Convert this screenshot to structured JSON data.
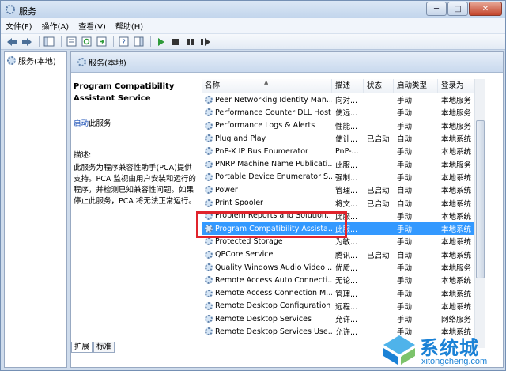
{
  "window": {
    "title": "服务"
  },
  "window_controls": {
    "minimize": "─",
    "maximize": "□",
    "close": "✕"
  },
  "menu": [
    "文件(F)",
    "操作(A)",
    "查看(V)",
    "帮助(H)"
  ],
  "tree": {
    "item": "服务(本地)"
  },
  "pane": {
    "header": "服务(本地)"
  },
  "description": {
    "title": "Program Compatibility Assistant Service",
    "start_link": "启动",
    "start_suffix": "此服务",
    "label": "描述:",
    "text": "此服务为程序兼容性助手(PCA)提供支持。PCA 监视由用户安装和运行的程序，并检测已知兼容性问题。如果停止此服务，PCA 将无法正常运行。"
  },
  "table": {
    "columns": [
      "名称",
      "描述",
      "状态",
      "启动类型",
      "登录为"
    ],
    "rows": [
      {
        "name": "Peer Networking Identity Man...",
        "desc": "向对...",
        "status": "",
        "startup": "手动",
        "logon": "本地服务"
      },
      {
        "name": "Performance Counter DLL Host",
        "desc": "使远...",
        "status": "",
        "startup": "手动",
        "logon": "本地服务"
      },
      {
        "name": "Performance Logs & Alerts",
        "desc": "性能...",
        "status": "",
        "startup": "手动",
        "logon": "本地服务"
      },
      {
        "name": "Plug and Play",
        "desc": "使计...",
        "status": "已启动",
        "startup": "自动",
        "logon": "本地系统"
      },
      {
        "name": "PnP-X IP Bus Enumerator",
        "desc": "PnP-...",
        "status": "",
        "startup": "手动",
        "logon": "本地系统"
      },
      {
        "name": "PNRP Machine Name Publicati...",
        "desc": "此服...",
        "status": "",
        "startup": "手动",
        "logon": "本地服务"
      },
      {
        "name": "Portable Device Enumerator S...",
        "desc": "强制...",
        "status": "",
        "startup": "手动",
        "logon": "本地系统"
      },
      {
        "name": "Power",
        "desc": "管理...",
        "status": "已启动",
        "startup": "自动",
        "logon": "本地系统"
      },
      {
        "name": "Print Spooler",
        "desc": "将文...",
        "status": "已启动",
        "startup": "自动",
        "logon": "本地系统"
      },
      {
        "name": "Problem Reports and Solution...",
        "desc": "此服...",
        "status": "",
        "startup": "手动",
        "logon": "本地系统"
      },
      {
        "name": "Program Compatibility Assista...",
        "desc": "此服...",
        "status": "",
        "startup": "手动",
        "logon": "本地系统",
        "selected": true
      },
      {
        "name": "Protected Storage",
        "desc": "为敏...",
        "status": "",
        "startup": "手动",
        "logon": "本地系统"
      },
      {
        "name": "QPCore Service",
        "desc": "腾讯...",
        "status": "已启动",
        "startup": "自动",
        "logon": "本地系统"
      },
      {
        "name": "Quality Windows Audio Video ...",
        "desc": "优质...",
        "status": "",
        "startup": "手动",
        "logon": "本地服务"
      },
      {
        "name": "Remote Access Auto Connecti...",
        "desc": "无论...",
        "status": "",
        "startup": "手动",
        "logon": "本地系统"
      },
      {
        "name": "Remote Access Connection M...",
        "desc": "管理...",
        "status": "",
        "startup": "手动",
        "logon": "本地系统"
      },
      {
        "name": "Remote Desktop Configuration",
        "desc": "远程...",
        "status": "",
        "startup": "手动",
        "logon": "本地系统"
      },
      {
        "name": "Remote Desktop Services",
        "desc": "允许...",
        "status": "",
        "startup": "手动",
        "logon": "网络服务"
      },
      {
        "name": "Remote Desktop Services Use...",
        "desc": "允许...",
        "status": "",
        "startup": "手动",
        "logon": "本地系统"
      }
    ]
  },
  "tabs": [
    "扩展",
    "标准"
  ],
  "watermark": {
    "cn": "系统城",
    "en": "xitongcheng.com"
  },
  "colors": {
    "selection": "#3399ff",
    "highlight_box": "#e0242c",
    "link": "#1a4fb6"
  }
}
